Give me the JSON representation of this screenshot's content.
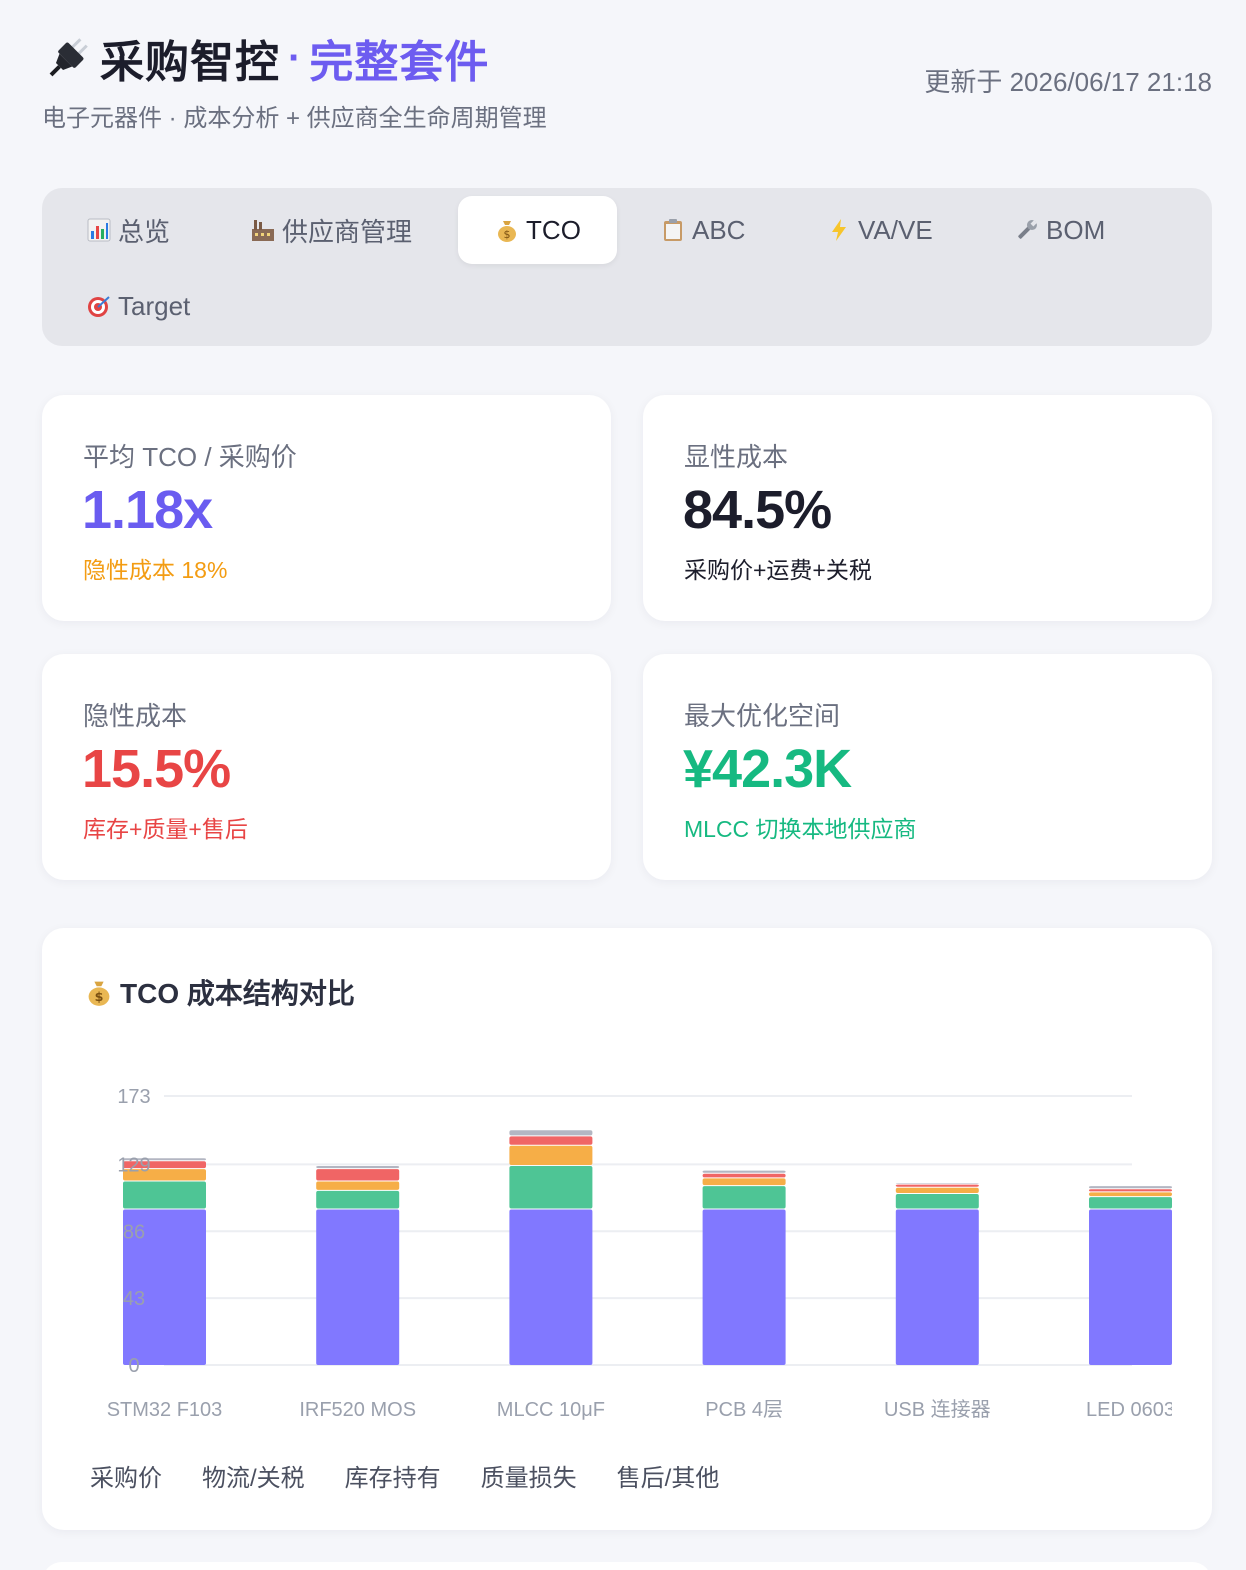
{
  "header": {
    "icon": "plug-icon",
    "title": "采购智控",
    "dot": "·",
    "suite": "完整套件",
    "subtitle": "电子元器件 · 成本分析 + 供应商全生命周期管理",
    "updated": "更新于 2026/06/17 21:18"
  },
  "tabs": [
    {
      "icon": "bar-chart-icon",
      "label": "总览",
      "active": false
    },
    {
      "icon": "factory-icon",
      "label": "供应商管理",
      "active": false
    },
    {
      "icon": "money-bag-icon",
      "label": "TCO",
      "active": true
    },
    {
      "icon": "clipboard-icon",
      "label": "ABC",
      "active": false
    },
    {
      "icon": "lightning-icon",
      "label": "VA/VE",
      "active": false
    },
    {
      "icon": "wrench-icon",
      "label": "BOM",
      "active": false
    },
    {
      "icon": "target-icon",
      "label": "Target",
      "active": false
    }
  ],
  "kpis": [
    {
      "label": "平均 TCO / 采购价",
      "value": "1.18x",
      "note": "隐性成本 18%",
      "value_color": "#6a5cf0",
      "note_color": "#f39c12"
    },
    {
      "label": "显性成本",
      "value": "84.5%",
      "note": "采购价+运费+关税",
      "value_color": "#1c1d2b",
      "note_color": "#1c1d2b"
    },
    {
      "label": "隐性成本",
      "value": "15.5%",
      "note": "库存+质量+售后",
      "value_color": "#e84545",
      "note_color": "#e84545"
    },
    {
      "label": "最大优化空间",
      "value": "¥42.3K",
      "note": "MLCC 切换本地供应商",
      "value_color": "#16b981",
      "note_color": "#16b981"
    }
  ],
  "chart": {
    "icon": "money-bag-icon",
    "title": "TCO 成本结构对比"
  },
  "chart_data": {
    "type": "bar",
    "stacked": true,
    "categories": [
      "STM32 F103",
      "IRF520 MOS",
      "MLCC 10μF",
      "PCB 4层",
      "USB 连接器",
      "LED 0603"
    ],
    "series": [
      {
        "name": "采购价",
        "color": "#8178ff",
        "values": [
          100,
          100,
          100,
          100,
          100,
          100
        ]
      },
      {
        "name": "物流/关税",
        "color": "#4ec595",
        "values": [
          18,
          12,
          28,
          15,
          10,
          8
        ]
      },
      {
        "name": "库存持有",
        "color": "#f6ae47",
        "values": [
          8,
          6,
          13,
          5,
          4,
          3
        ]
      },
      {
        "name": "质量损失",
        "color": "#f06565",
        "values": [
          5,
          8,
          6,
          3,
          2,
          2
        ]
      },
      {
        "name": "售后/其他",
        "color": "#b3b6c2",
        "values": [
          2,
          2,
          4,
          2,
          1,
          2
        ]
      }
    ],
    "y_ticks": [
      "0",
      "43",
      "86",
      "129",
      "173"
    ],
    "ylim": [
      0,
      173
    ],
    "grid": true,
    "legend": "bottom-left"
  }
}
